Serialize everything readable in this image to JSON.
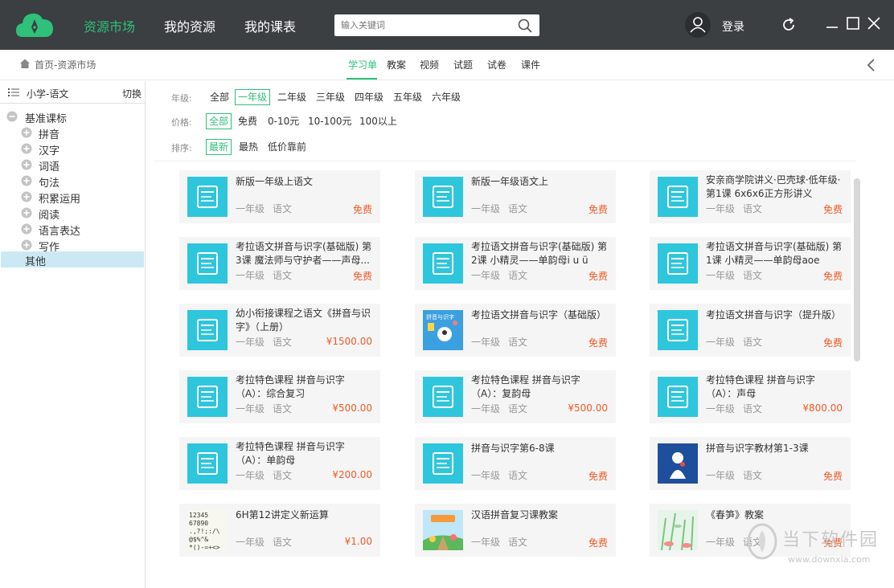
{
  "header": {
    "nav": [
      "资源市场",
      "我的资源",
      "我的课表"
    ],
    "search_placeholder": "输入关键词",
    "login_label": "登录"
  },
  "subbar": {
    "breadcrumb": "首页-资源市场",
    "tabs": [
      "学习单",
      "教案",
      "视频",
      "试题",
      "试卷",
      "课件"
    ],
    "active_tab": "学习单"
  },
  "sidebar": {
    "title": "小学-语文",
    "switch_label": "切换",
    "root": "基准课标",
    "nodes": [
      "拼音",
      "汉字",
      "词语",
      "句法",
      "积累运用",
      "阅读",
      "语言表达",
      "写作"
    ],
    "selected": "其他"
  },
  "filters": {
    "grade": {
      "label": "年级:",
      "options": [
        "全部",
        "一年级",
        "二年级",
        "三年级",
        "四年级",
        "五年级",
        "六年级"
      ],
      "selected": "一年级"
    },
    "price": {
      "label": "价格:",
      "options": [
        "全部",
        "免费",
        "0-10元",
        "10-100元",
        "100以上"
      ],
      "selected": "全部"
    },
    "sort": {
      "label": "排序:",
      "options": [
        "最新",
        "最热",
        "低价靠前"
      ],
      "selected": "最新"
    }
  },
  "cards": [
    {
      "title": "新版一年级上语文",
      "grade": "一年级",
      "subject": "语文",
      "price": "免费",
      "thumb": "doc-icon"
    },
    {
      "title": "新版一年级语文上",
      "grade": "一年级",
      "subject": "语文",
      "price": "免费",
      "thumb": "doc-icon"
    },
    {
      "title": "安亲商学院讲义·巴壳球·低年级·第1课 6x6x6正方形讲义",
      "grade": "一年级",
      "subject": "语文",
      "price": "免费",
      "thumb": "doc-icon"
    },
    {
      "title": "考拉语文拼音与识字(基础版) 第3课 魔法师与守护者——声母...",
      "grade": "一年级",
      "subject": "语文",
      "price": "免费",
      "thumb": "doc-icon"
    },
    {
      "title": "考拉语文拼音与识字(基础版) 第2课 小精灵——单韵母i u ü",
      "grade": "一年级",
      "subject": "语文",
      "price": "免费",
      "thumb": "doc-icon"
    },
    {
      "title": "考拉语文拼音与识字(基础版) 第1课 小精灵——单韵母aoe",
      "grade": "一年级",
      "subject": "语文",
      "price": "免费",
      "thumb": "doc-icon"
    },
    {
      "title": "幼小衔接课程之语文《拼音与识字》（上册）",
      "grade": "一年级",
      "subject": "语文",
      "price": "¥1500.00",
      "thumb": "doc-icon"
    },
    {
      "title": "考拉语文拼音与识字（基础版）",
      "grade": "一年级",
      "subject": "语文",
      "price": "免费",
      "thumb": "cover-image"
    },
    {
      "title": "考拉语文拼音与识字（提升版）",
      "grade": "一年级",
      "subject": "语文",
      "price": "免费",
      "thumb": "doc-icon"
    },
    {
      "title": "考拉特色课程 拼音与识字（A）：综合复习",
      "grade": "一年级",
      "subject": "语文",
      "price": "¥500.00",
      "thumb": "doc-icon"
    },
    {
      "title": "考拉特色课程 拼音与识字（A）：复韵母",
      "grade": "一年级",
      "subject": "语文",
      "price": "¥500.00",
      "thumb": "doc-icon"
    },
    {
      "title": "考拉特色课程 拼音与识字（A）：声母",
      "grade": "一年级",
      "subject": "语文",
      "price": "¥800.00",
      "thumb": "doc-icon"
    },
    {
      "title": "考拉特色课程 拼音与识字（A）：单韵母",
      "grade": "一年级",
      "subject": "语文",
      "price": "¥200.00",
      "thumb": "doc-icon"
    },
    {
      "title": "拼音与识字第6-8课",
      "grade": "一年级",
      "subject": "语文",
      "price": "免费",
      "thumb": "doc-icon"
    },
    {
      "title": "拼音与识字教材第1-3课",
      "grade": "一年级",
      "subject": "语文",
      "price": "免费",
      "thumb": "blue-cover-image"
    },
    {
      "title": "6H第12讲定义新运算",
      "grade": "一年级",
      "subject": "语文",
      "price": "¥1.00",
      "thumb": "number-image"
    },
    {
      "title": "汉语拼音复习课教案",
      "grade": "一年级",
      "subject": "语文",
      "price": "免费",
      "thumb": "cartoon-image"
    },
    {
      "title": "《春笋》教案",
      "grade": "一年级",
      "subject": "语文",
      "price": "免费",
      "thumb": "bamboo-image"
    }
  ],
  "thumb_text": {
    "cover": "拼音与识字",
    "number": [
      "12345",
      "67890",
      ".,?!;:/\\",
      "@$%^&",
      "*()-=+<>"
    ]
  },
  "watermark": {
    "brand": "当下软件园",
    "url": "www.downxia.com"
  },
  "colors": {
    "accent": "#2fc07a",
    "topbar": "#3b3f42",
    "thumb": "#2ec6dc",
    "price": "#f05a28",
    "selected_bg": "#cbe9f5"
  }
}
